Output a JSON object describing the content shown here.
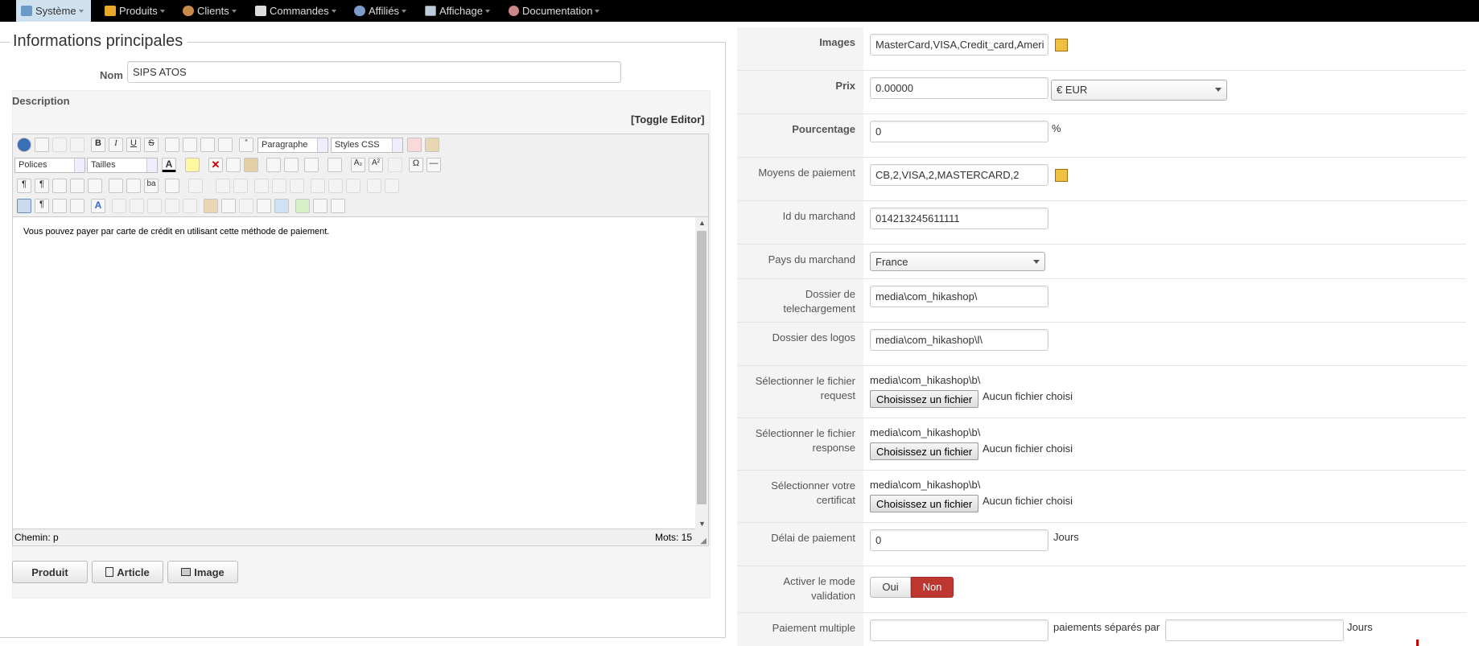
{
  "menu": {
    "items": [
      {
        "label": "Système",
        "icon": "wrench-icon"
      },
      {
        "label": "Produits",
        "icon": "folder-icon"
      },
      {
        "label": "Clients",
        "icon": "users-icon"
      },
      {
        "label": "Commandes",
        "icon": "document-icon"
      },
      {
        "label": "Affiliés",
        "icon": "people-icon"
      },
      {
        "label": "Affichage",
        "icon": "display-icon"
      },
      {
        "label": "Documentation",
        "icon": "help-icon"
      }
    ]
  },
  "main": {
    "legend": "Informations principales",
    "name_label": "Nom",
    "name_value": "SIPS ATOS",
    "description_label": "Description",
    "toggle_editor": "[Toggle Editor]",
    "editor": {
      "format_select": "Paragraphe",
      "styles_select": "Styles CSS",
      "font_select": "Polices",
      "size_select": "Tailles",
      "content": "Vous pouvez payer par carte de crédit en utilisant cette méthode de paiement.",
      "path": "Chemin: p",
      "words": "Mots: 15"
    },
    "buttons": {
      "produit": "Produit",
      "article": "Article",
      "image": "Image"
    }
  },
  "params": {
    "images_label": "Images",
    "images_value": "MasterCard,VISA,Credit_card,Ameri",
    "prix_label": "Prix",
    "prix_value": "0.00000",
    "currency": "€ EUR",
    "pourcentage_label": "Pourcentage",
    "pourcentage_value": "0",
    "percent_sign": "%",
    "moyens_label": "Moyens de paiement",
    "moyens_value": "CB,2,VISA,2,MASTERCARD,2",
    "id_label": "Id du marchand",
    "id_value": "014213245611111",
    "pays_label": "Pays du marchand",
    "pays_value": "France",
    "dossier_tele_label_1": "Dossier de",
    "dossier_tele_label_2": "telechargement",
    "dossier_tele_value": "media\\com_hikashop\\",
    "dossier_logos_label": "Dossier des logos",
    "dossier_logos_value": "media\\com_hikashop\\l\\",
    "request_label_1": "Sélectionner le fichier",
    "request_label_2": "request",
    "request_path": "media\\com_hikashop\\b\\",
    "response_label_1": "Sélectionner le fichier",
    "response_label_2": "response",
    "response_path": "media\\com_hikashop\\b\\",
    "cert_label_1": "Sélectionner votre",
    "cert_label_2": "certificat",
    "cert_path": "media\\com_hikashop\\b\\",
    "choose_file": "Choisissez un fichier",
    "no_file": "Aucun fichier choisi",
    "delai_label": "Délai de paiement",
    "delai_value": "0",
    "jours": "Jours",
    "validation_label_1": "Activer le mode",
    "validation_label_2": "validation",
    "oui": "Oui",
    "non": "Non",
    "multiple_label": "Paiement multiple",
    "multiple_middle": "paiements séparés par",
    "multiple_jours": "Jours"
  },
  "colors": {
    "topbar": "#000000",
    "active_menu": "#cfe0ee",
    "non_button": "#bd362f"
  }
}
